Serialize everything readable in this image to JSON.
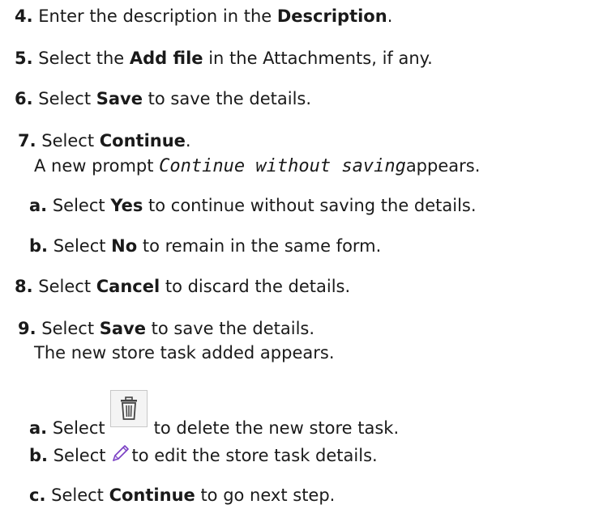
{
  "steps": [
    {
      "num": "4.",
      "pre": "Enter the description in the ",
      "bold": "Description",
      "post": "."
    },
    {
      "num": "5.",
      "pre": "Select the ",
      "bold": "Add file",
      "post": " in the Attachments, if any."
    },
    {
      "num": "6.",
      "pre": "Select ",
      "bold": "Save",
      "post": " to save the details."
    },
    {
      "num": "7.",
      "pre": "Select ",
      "bold": "Continue",
      "post": ".",
      "note_pre": "A new prompt ",
      "note_mono": "Continue without saving",
      "note_post": "appears."
    },
    {
      "num": "a.",
      "pre": "Select ",
      "bold": "Yes",
      "post": " to continue without saving the details."
    },
    {
      "num": "b.",
      "pre": "Select ",
      "bold": "No",
      "post": " to remain in the same form."
    },
    {
      "num": "8.",
      "pre": "Select ",
      "bold": "Cancel",
      "post": " to discard the details."
    },
    {
      "num": "9.",
      "pre": "Select ",
      "bold": "Save",
      "post": " to save the details.",
      "note": "The new store task added appears."
    },
    {
      "num": "a.",
      "pre": "Select",
      "post": "to delete the new store task.",
      "icon": "trash-icon"
    },
    {
      "num": "b.",
      "pre": "Select",
      "post": "to edit the store task details.",
      "icon": "pencil-icon"
    },
    {
      "num": "c.",
      "pre": "Select ",
      "bold": "Continue",
      "post": " to go next step."
    }
  ]
}
